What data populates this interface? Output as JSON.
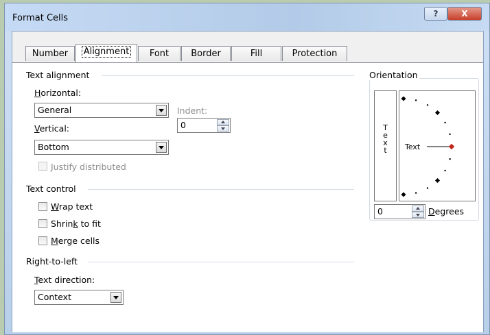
{
  "window": {
    "title": "Format Cells",
    "help_glyph": "?",
    "close_glyph": "X"
  },
  "tabs": [
    {
      "label": "Number"
    },
    {
      "label": "Alignment"
    },
    {
      "label": "Font"
    },
    {
      "label": "Border"
    },
    {
      "label": "Fill"
    },
    {
      "label": "Protection"
    }
  ],
  "active_tab": "Alignment",
  "text_alignment": {
    "heading": "Text alignment",
    "horizontal_label_u": "H",
    "horizontal_label_rest": "orizontal:",
    "horizontal_value": "General",
    "indent_label": "Indent:",
    "indent_value": "0",
    "vertical_label_u": "V",
    "vertical_label_rest": "ertical:",
    "vertical_value": "Bottom",
    "justify_label": "Justify distributed",
    "justify_checked": false,
    "justify_enabled": false
  },
  "text_control": {
    "heading": "Text control",
    "wrap_u": "W",
    "wrap_rest": "rap text",
    "shrink_pre": "Shrin",
    "shrink_u": "k",
    "shrink_post": " to fit",
    "merge_u": "M",
    "merge_rest": "erge cells",
    "wrap_checked": false,
    "shrink_checked": false,
    "merge_checked": false
  },
  "right_to_left": {
    "heading": "Right-to-left",
    "direction_label_u": "T",
    "direction_label_rest": "ext direction:",
    "direction_value": "Context"
  },
  "orientation": {
    "heading": "Orientation",
    "vertical_letters": [
      "T",
      "e",
      "x",
      "t"
    ],
    "dial_text": "Text",
    "degrees_value": "0",
    "degrees_label_u": "D",
    "degrees_label_rest": "egrees",
    "angle_deg": 0,
    "colors": {
      "indicator": "#c0281c",
      "dot": "#000000"
    }
  },
  "icons": [
    "help-icon",
    "close-icon",
    "dropdown-arrow-icon",
    "spin-up-icon",
    "spin-down-icon"
  ]
}
